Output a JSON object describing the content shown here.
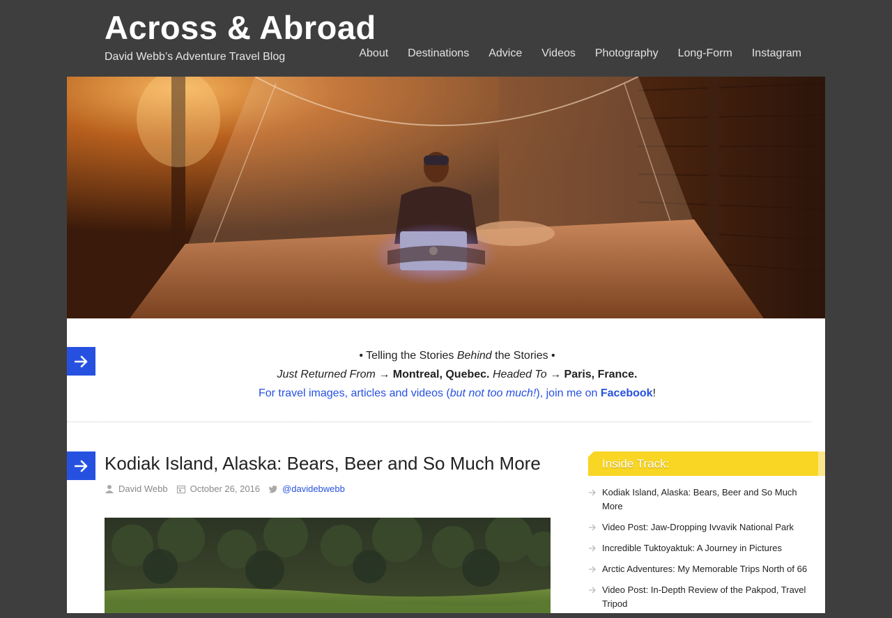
{
  "site": {
    "title": "Across & Abroad",
    "tagline": "David Webb’s Adventure Travel Blog"
  },
  "nav": {
    "items": [
      {
        "label": "About"
      },
      {
        "label": "Destinations"
      },
      {
        "label": "Advice"
      },
      {
        "label": "Videos"
      },
      {
        "label": "Photography"
      },
      {
        "label": "Long-Form"
      },
      {
        "label": "Instagram"
      }
    ]
  },
  "intro": {
    "line1_pre": "• Telling the Stories ",
    "line1_em": "Behind",
    "line1_post": " the Stories •",
    "line2_returned_label": "Just Returned From",
    "line2_arrow1": " → ",
    "line2_returned_place": "Montreal, Quebec.",
    "line2_headed_label": "Headed To",
    "line2_arrow2": " → ",
    "line2_headed_place": "Paris, France.",
    "line3_pre": "For travel images, articles and videos (",
    "line3_em": "but not too much!",
    "line3_mid": "), join me on ",
    "line3_link": "Facebook",
    "line3_post": "!"
  },
  "post": {
    "title": "Kodiak Island, Alaska: Bears, Beer and So Much More",
    "author": "David Webb",
    "date": "October 26, 2016",
    "twitter": "@davidebwebb"
  },
  "sidebar": {
    "widget_title": "Inside Track:",
    "items": [
      {
        "label": "Kodiak Island, Alaska: Bears, Beer and So Much More"
      },
      {
        "label": "Video Post: Jaw-Dropping Ivvavik National Park"
      },
      {
        "label": "Incredible Tuktoyaktuk: A Journey in Pictures"
      },
      {
        "label": "Arctic Adventures: My Memorable Trips North of 66"
      },
      {
        "label": "Video Post: In-Depth Review of the Pakpod, Travel Tripod"
      }
    ]
  },
  "colors": {
    "header_bg": "#3e3e3e",
    "accent_blue": "#2651e0",
    "widget_yellow": "#f9d524"
  }
}
